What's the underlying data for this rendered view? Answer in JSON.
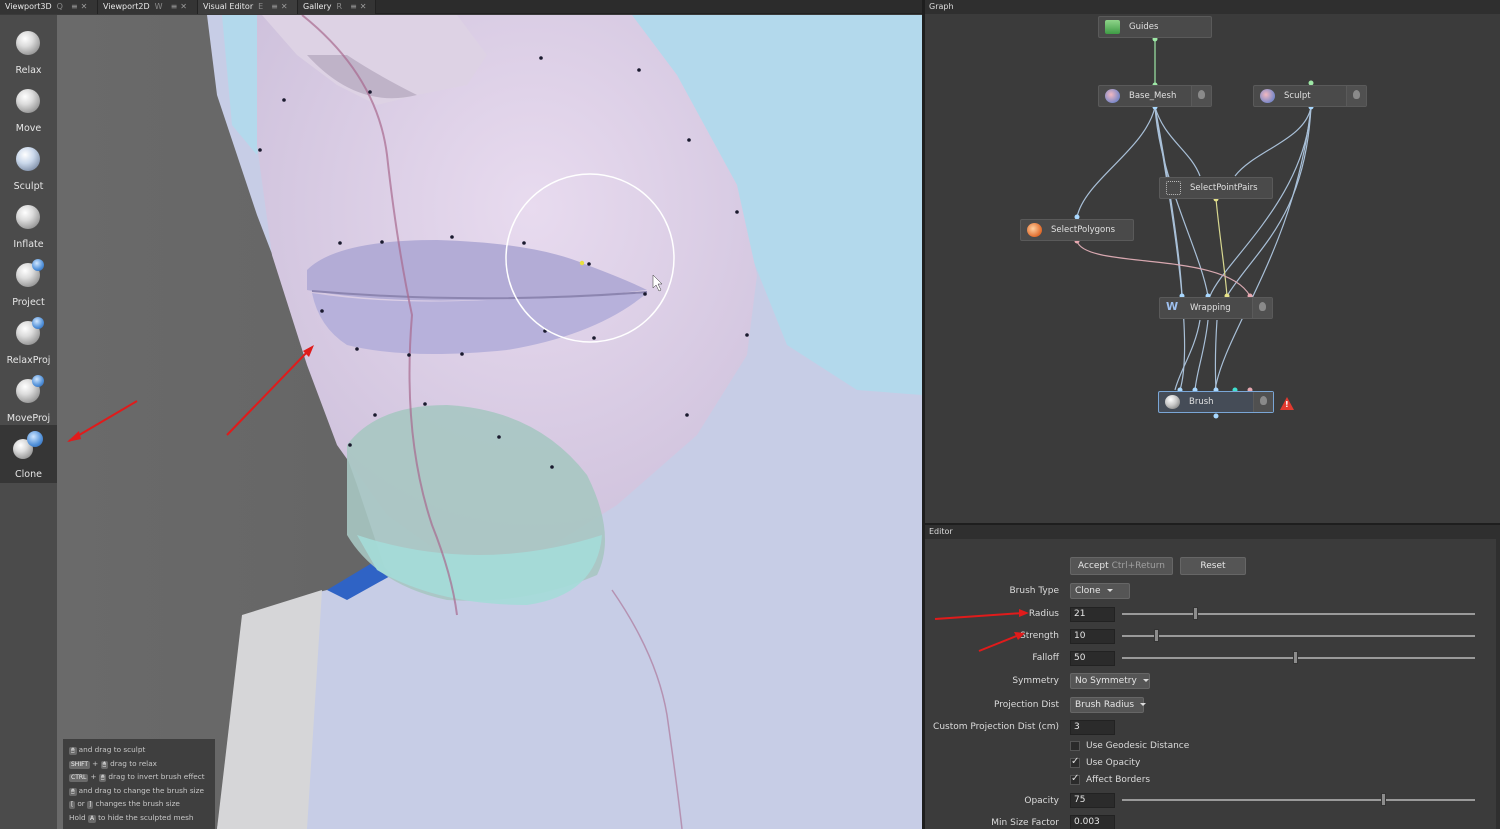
{
  "tabs": [
    {
      "label": "Viewport3D",
      "shortcut": "Q"
    },
    {
      "label": "Viewport2D",
      "shortcut": "W"
    },
    {
      "label": "Visual Editor",
      "shortcut": "E"
    },
    {
      "label": "Gallery",
      "shortcut": "R"
    }
  ],
  "tools": [
    {
      "label": "Relax",
      "icon": "relax-brush-icon"
    },
    {
      "label": "Move",
      "icon": "move-brush-icon"
    },
    {
      "label": "Sculpt",
      "icon": "sculpt-brush-icon"
    },
    {
      "label": "Inflate",
      "icon": "inflate-brush-icon"
    },
    {
      "label": "Project",
      "icon": "project-brush-icon"
    },
    {
      "label": "RelaxProj",
      "icon": "relaxproj-brush-icon"
    },
    {
      "label": "MoveProj",
      "icon": "moveproj-brush-icon"
    },
    {
      "label": "Clone",
      "icon": "clone-brush-icon",
      "active": true
    }
  ],
  "hints": {
    "l1": "and drag to sculpt",
    "k2": "SHIFT",
    "l2": "drag to relax",
    "k3": "CTRL",
    "l3": "drag to invert brush effect",
    "l4": "and drag to change the brush size",
    "k5a": "[",
    "l5a": "or",
    "k5b": "]",
    "l5b": "changes the brush size",
    "l6a": "Hold",
    "k6": "A",
    "l6b": "to hide the sculpted mesh"
  },
  "graph": {
    "title": "Graph",
    "nodes": {
      "guides": "Guides",
      "base_mesh": "Base_Mesh",
      "sculpt": "Sculpt",
      "select_point_pairs": "SelectPointPairs",
      "select_polygons": "SelectPolygons",
      "wrapping": "Wrapping",
      "brush": "Brush"
    }
  },
  "editor": {
    "title": "Editor",
    "accept_label": "Accept",
    "accept_shortcut": "Ctrl+Return",
    "reset_label": "Reset",
    "brush_type_label": "Brush Type",
    "brush_type_value": "Clone",
    "radius_label": "Radius",
    "radius_value": "21",
    "strength_label": "Strength",
    "strength_value": "10",
    "falloff_label": "Falloff",
    "falloff_value": "50",
    "symmetry_label": "Symmetry",
    "symmetry_value": "No Symmetry",
    "projection_dist_label": "Projection Dist",
    "projection_dist_value": "Brush Radius",
    "custom_projection_label": "Custom Projection Dist (cm)",
    "custom_projection_value": "3",
    "use_geodesic_label": "Use Geodesic Distance",
    "use_geodesic_checked": false,
    "use_opacity_label": "Use Opacity",
    "use_opacity_checked": true,
    "affect_borders_label": "Affect Borders",
    "affect_borders_checked": true,
    "opacity_label": "Opacity",
    "opacity_value": "75",
    "min_size_factor_label": "Min Size Factor",
    "min_size_factor_value": "0.003"
  }
}
